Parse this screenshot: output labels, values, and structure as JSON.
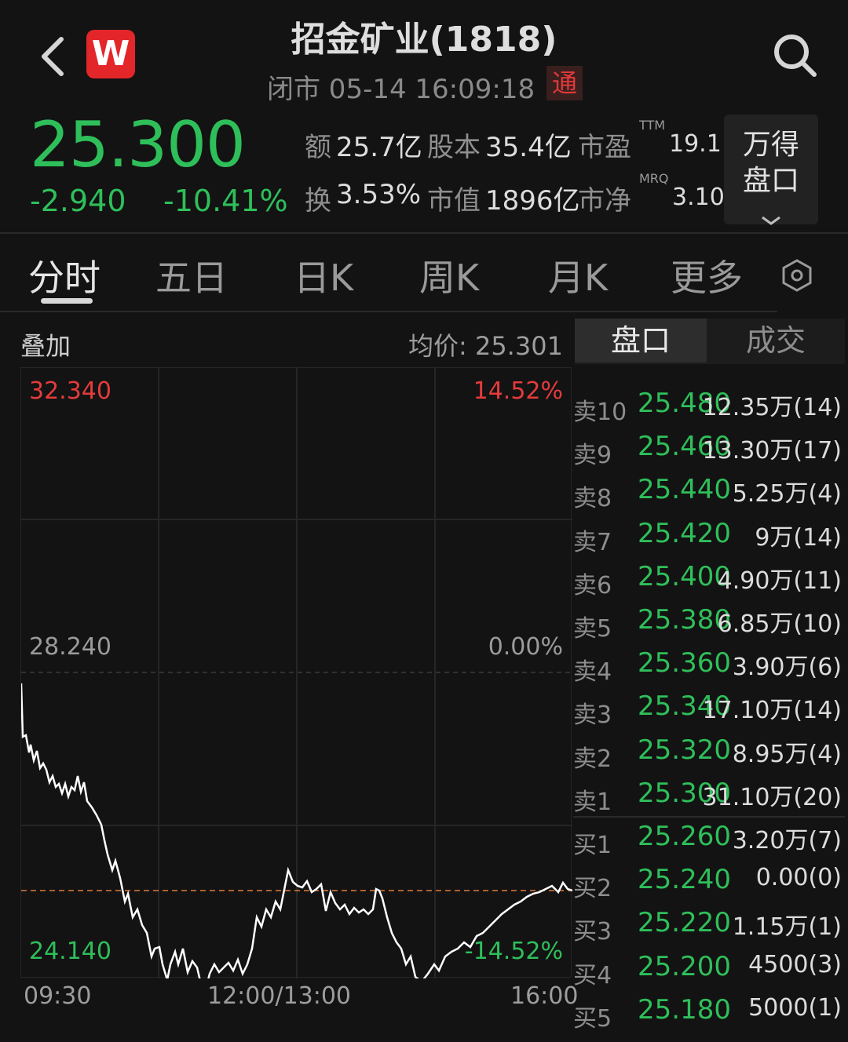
{
  "header": {
    "title": "招金矿业(1818)",
    "status": "闭市 05-14 16:09:18",
    "connect_badge": "通",
    "logo": "W"
  },
  "quote": {
    "price": "25.300",
    "change": "-2.940",
    "change_pct": "-10.41%",
    "amount_label": "额",
    "amount": "25.7亿",
    "capital_label": "股本",
    "capital": "35.4亿",
    "pe_label": "市盈",
    "pe_sup": "TTM",
    "pe": "19.1",
    "turnover_label": "换",
    "turnover": "3.53%",
    "mcap_label": "市值",
    "mcap": "1896亿",
    "pb_label": "市净",
    "pb_sup": "MRQ",
    "pb": "3.10",
    "wind_panel_line1": "万得",
    "wind_panel_line2": "盘口"
  },
  "tabs": [
    "分时",
    "五日",
    "日K",
    "周K",
    "月K",
    "更多"
  ],
  "chart": {
    "overlay_label": "叠加",
    "avg_price": "均价:  25.301",
    "top_price": "32.340",
    "top_pct": "14.52%",
    "mid_price": "28.240",
    "mid_pct": "0.00%",
    "bottom_price": "24.140",
    "bottom_pct": "-14.52%",
    "time_start": "09:30",
    "time_mid": "12:00/13:00",
    "time_end": "16:00",
    "colors": {
      "up": "#e53b3b",
      "down": "#2fbf5a",
      "line": "#ffffff",
      "ref": "#e07a3a"
    }
  },
  "orderbook": {
    "tab_book": "盘口",
    "tab_trades": "成交",
    "sells": [
      {
        "label": "卖10",
        "price": "25.480",
        "vol": "12.35万(14)"
      },
      {
        "label": "卖9",
        "price": "25.460",
        "vol": "13.30万(17)"
      },
      {
        "label": "卖8",
        "price": "25.440",
        "vol": "5.25万(4)"
      },
      {
        "label": "卖7",
        "price": "25.420",
        "vol": "9万(14)"
      },
      {
        "label": "卖6",
        "price": "25.400",
        "vol": "4.90万(11)"
      },
      {
        "label": "卖5",
        "price": "25.380",
        "vol": "6.85万(10)"
      },
      {
        "label": "卖4",
        "price": "25.360",
        "vol": "3.90万(6)"
      },
      {
        "label": "卖3",
        "price": "25.340",
        "vol": "17.10万(14)"
      },
      {
        "label": "卖2",
        "price": "25.320",
        "vol": "8.95万(4)"
      },
      {
        "label": "卖1",
        "price": "25.300",
        "vol": "31.10万(20)"
      }
    ],
    "buys": [
      {
        "label": "买1",
        "price": "25.260",
        "vol": "3.20万(7)"
      },
      {
        "label": "买2",
        "price": "25.240",
        "vol": "0.00(0)"
      },
      {
        "label": "买3",
        "price": "25.220",
        "vol": "1.15万(1)"
      },
      {
        "label": "买4",
        "price": "25.200",
        "vol": "4500(3)"
      },
      {
        "label": "买5",
        "price": "25.180",
        "vol": "5000(1)"
      }
    ]
  }
}
